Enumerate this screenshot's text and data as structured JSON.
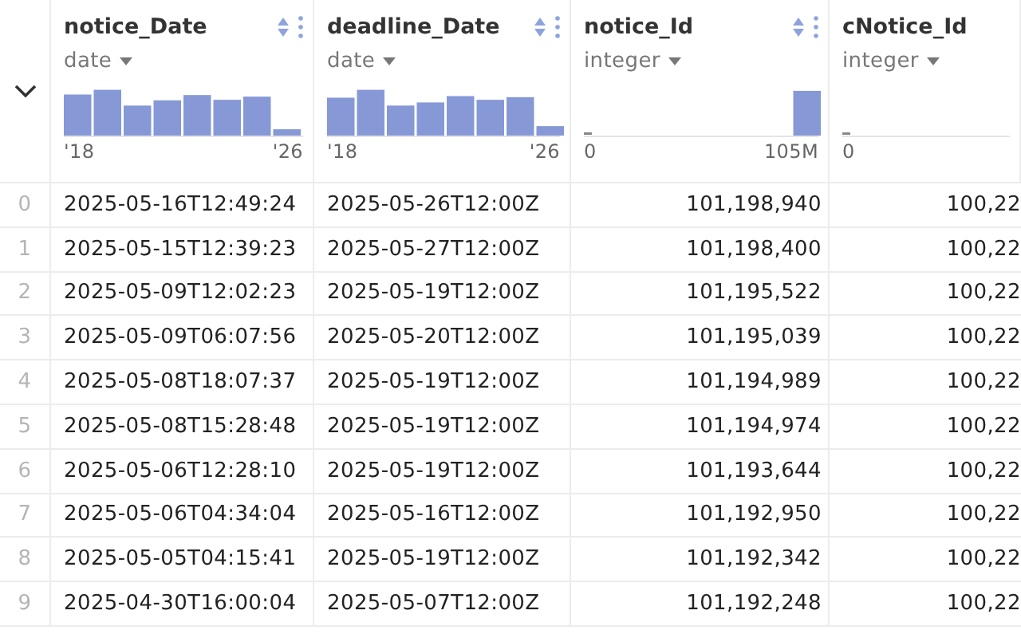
{
  "table": {
    "columns": [
      {
        "name": "notice_Date",
        "dtype": "date",
        "axis_min": "'18",
        "axis_max": "'26",
        "controls": true
      },
      {
        "name": "deadline_Date",
        "dtype": "date",
        "axis_min": "'18",
        "axis_max": "'26",
        "controls": true
      },
      {
        "name": "notice_Id",
        "dtype": "integer",
        "axis_min": "0",
        "axis_max": "105M",
        "controls": true
      },
      {
        "name": "cNotice_Id",
        "dtype": "integer",
        "axis_min": "0",
        "controls": false
      }
    ],
    "rows": [
      {
        "index": "0",
        "cells": [
          "2025-05-16T12:49:24",
          "2025-05-26T12:00Z",
          "101,198,940",
          "100,22"
        ]
      },
      {
        "index": "1",
        "cells": [
          "2025-05-15T12:39:23",
          "2025-05-27T12:00Z",
          "101,198,400",
          "100,22"
        ]
      },
      {
        "index": "2",
        "cells": [
          "2025-05-09T12:02:23",
          "2025-05-19T12:00Z",
          "101,195,522",
          "100,22"
        ]
      },
      {
        "index": "3",
        "cells": [
          "2025-05-09T06:07:56",
          "2025-05-20T12:00Z",
          "101,195,039",
          "100,22"
        ]
      },
      {
        "index": "4",
        "cells": [
          "2025-05-08T18:07:37",
          "2025-05-19T12:00Z",
          "101,194,989",
          "100,22"
        ]
      },
      {
        "index": "5",
        "cells": [
          "2025-05-08T15:28:48",
          "2025-05-19T12:00Z",
          "101,194,974",
          "100,22"
        ]
      },
      {
        "index": "6",
        "cells": [
          "2025-05-06T12:28:10",
          "2025-05-19T12:00Z",
          "101,193,644",
          "100,22"
        ]
      },
      {
        "index": "7",
        "cells": [
          "2025-05-06T04:34:04",
          "2025-05-16T12:00Z",
          "101,192,950",
          "100,22"
        ]
      },
      {
        "index": "8",
        "cells": [
          "2025-05-05T04:15:41",
          "2025-05-19T12:00Z",
          "101,192,342",
          "100,22"
        ]
      },
      {
        "index": "9",
        "cells": [
          "2025-04-30T16:00:04",
          "2025-05-07T12:00Z",
          "101,192,248",
          "100,22"
        ]
      }
    ]
  }
}
